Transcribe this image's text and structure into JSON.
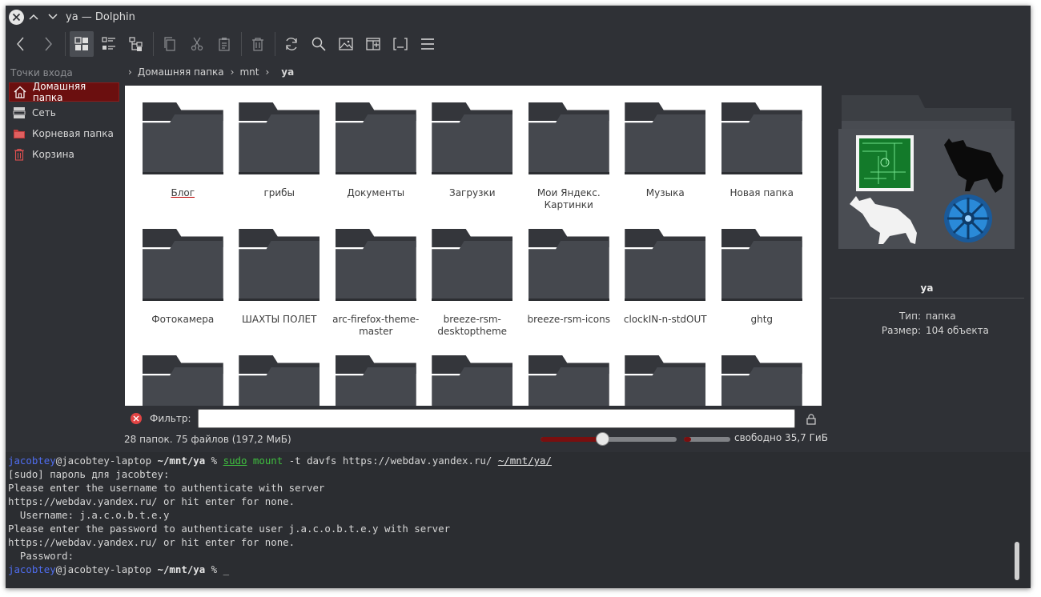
{
  "window": {
    "title": "ya — Dolphin"
  },
  "places": {
    "title": "Точки входа",
    "items": [
      {
        "label": "Домашняя папка",
        "icon": "home-icon",
        "selected": true
      },
      {
        "label": "Сеть",
        "icon": "network-icon",
        "selected": false
      },
      {
        "label": "Корневая папка",
        "icon": "root-folder-icon",
        "selected": false
      },
      {
        "label": "Корзина",
        "icon": "trash-icon",
        "selected": false
      }
    ]
  },
  "breadcrumb": {
    "items": [
      "Домашняя папка",
      "mnt"
    ],
    "current": "ya"
  },
  "files": [
    "Блог",
    "грибы",
    "Документы",
    "Загрузки",
    "Мои Яндекс. Картинки",
    "Музыка",
    "Новая папка",
    "Фотокамера",
    "ШАХТЫ ПОЛЕТ",
    "arc-firefox-theme-master",
    "breeze-rsm-desktoptheme",
    "breeze-rsm-icons",
    "clockIN-n-stdOUT",
    "ghtg",
    "",
    "",
    "",
    "",
    "",
    "",
    ""
  ],
  "info": {
    "name": "ya",
    "type_label": "Тип:",
    "type_value": "папка",
    "size_label": "Размер:",
    "size_value": "104 объекта"
  },
  "filter": {
    "label": "Фильтр:",
    "value": ""
  },
  "status": {
    "summary": "28 папок. 75 файлов (197,2 МиБ)",
    "zoom_fraction": 0.45,
    "used_fraction": 0.15,
    "free_text": "свободно 35,7 ГиБ"
  },
  "terminal": {
    "user": "jacobtey",
    "host": "@jacobtey-laptop",
    "cwd": "~/mnt/ya",
    "prompt_char": "%",
    "cmd1": "sudo",
    "cmd1_sub": "mount",
    "cmd1_args": "-t davfs https://webdav.yandex.ru/",
    "cmd1_target": "~/mnt/ya/",
    "output": [
      "[sudo] пароль для jacobtey:",
      "Please enter the username to authenticate with server",
      "https://webdav.yandex.ru/ or hit enter for none.",
      "  Username: j.a.c.o.b.t.e.y",
      "Please enter the password to authenticate user j.a.c.o.b.t.e.y with server",
      "https://webdav.yandex.ru/ or hit enter for none.",
      "  Password:"
    ],
    "cursor": "_"
  },
  "colors": {
    "accent": "#6b0f0f",
    "window_bg": "#2f3136",
    "folder": "#45484e",
    "terminal_user": "#4f6df0",
    "terminal_cmd": "#3fbf3f"
  }
}
